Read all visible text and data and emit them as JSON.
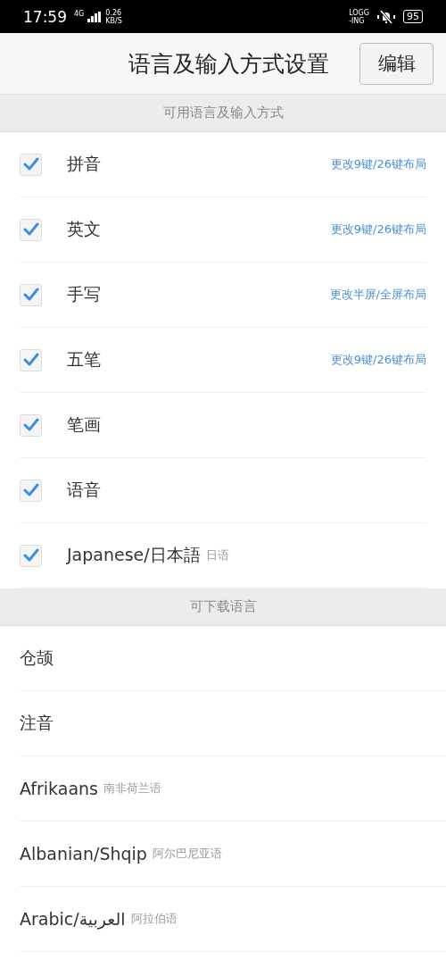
{
  "status_bar": {
    "time": "17:59",
    "network": "4G",
    "speed": "0.26",
    "speed_unit": "KB/S",
    "logging_1": "LOGG",
    "logging_2": "-ING",
    "battery": "95"
  },
  "header": {
    "title": "语言及输入方式设置",
    "edit_button": "编辑"
  },
  "available": {
    "heading": "可用语言及输入方式",
    "items": [
      {
        "name": "拼音",
        "checked": true,
        "action": "更改9键/26键布局"
      },
      {
        "name": "英文",
        "checked": true,
        "action": "更改9键/26键布局"
      },
      {
        "name": "手写",
        "checked": true,
        "action": "更改半屏/全屏布局"
      },
      {
        "name": "五笔",
        "checked": true,
        "action": "更改9键/26键布局"
      },
      {
        "name": "笔画",
        "checked": true
      },
      {
        "name": "语音",
        "checked": true
      },
      {
        "name": "Japanese/日本語",
        "note": "日语",
        "checked": true
      }
    ]
  },
  "downloadable": {
    "heading": "可下载语言",
    "items": [
      {
        "name": "仓颉"
      },
      {
        "name": "注音"
      },
      {
        "name": "Afrikaans",
        "note": "南非荷兰语"
      },
      {
        "name": "Albanian/Shqip",
        "note": "阿尔巴尼亚语"
      },
      {
        "name": "Arabic/العربية",
        "note": "阿拉伯语"
      }
    ]
  }
}
